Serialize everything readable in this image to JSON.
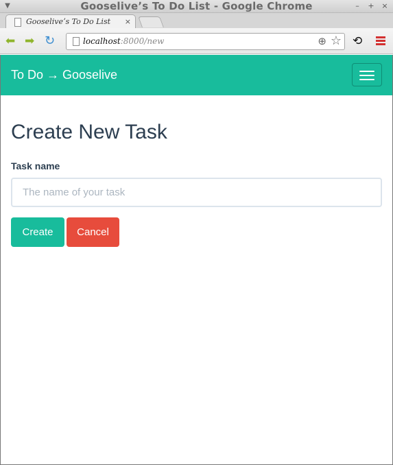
{
  "window": {
    "title": "Gooseliveʼs To Do List - Google Chrome",
    "controls": [
      "–",
      "+",
      "×"
    ]
  },
  "tab": {
    "title": "Gooseliveʼs To Do List",
    "close": "×"
  },
  "toolbar": {
    "url_host": "localhost",
    "url_path": ":8000/new"
  },
  "navbar": {
    "brand": "To Do → Gooselive"
  },
  "page": {
    "heading": "Create New Task",
    "task_label": "Task name",
    "task_placeholder": "The name of your task",
    "task_value": "",
    "create_label": "Create",
    "cancel_label": "Cancel"
  },
  "colors": {
    "accent": "#18bc9c",
    "danger": "#e74c3c",
    "text": "#2c3e50"
  }
}
